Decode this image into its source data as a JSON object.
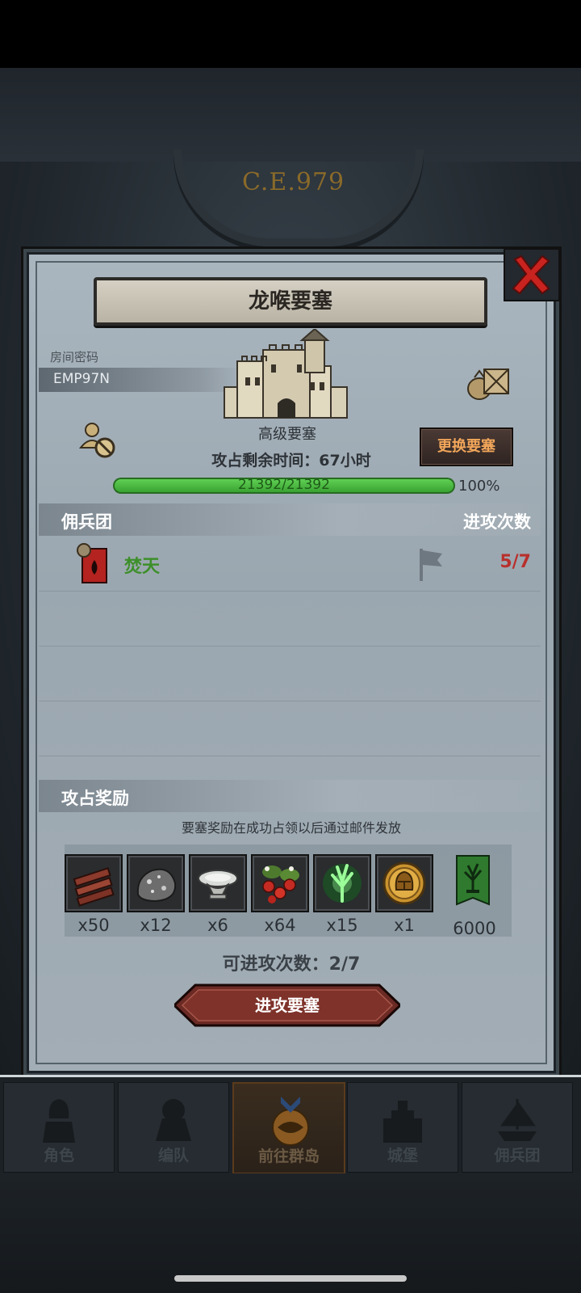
{
  "background": {
    "year_label": "C.E.979"
  },
  "modal": {
    "title": "龙喉要塞",
    "room_label": "房间密码",
    "room_code": "EMP97N",
    "fortress_type": "高级要塞",
    "change_button": "更换要塞",
    "time_label": "攻占剩余时间：",
    "time_value": "67",
    "time_unit": "小时",
    "hp_text": "21392/21392",
    "hp_percent": "100%",
    "hp_fraction": 1.0,
    "mercenary_header": "佣兵团",
    "attack_count_header": "进攻次数",
    "mercenaries": [
      {
        "name": "焚天",
        "attacks": "5/7"
      }
    ],
    "reward_header": "攻占奖励",
    "reward_note": "要塞奖励在成功占领以后通过邮件发放",
    "rewards": [
      {
        "icon": "wood-planks-icon",
        "qty": "x50"
      },
      {
        "icon": "stone-ore-icon",
        "qty": "x12"
      },
      {
        "icon": "silver-bowl-icon",
        "qty": "x6"
      },
      {
        "icon": "berries-icon",
        "qty": "x64"
      },
      {
        "icon": "green-spirit-tree-icon",
        "qty": "x15"
      },
      {
        "icon": "gold-helmet-coin-icon",
        "qty": "x1"
      },
      {
        "icon": "tree-banner-icon",
        "qty": "6000"
      }
    ],
    "attempts_text": "可进攻次数：2/7",
    "attack_button": "进攻要塞"
  },
  "nav": [
    {
      "label": "角色",
      "icon": "knight-icon"
    },
    {
      "label": "编队",
      "icon": "formation-icon"
    },
    {
      "label": "前往群岛",
      "icon": "island-map-icon",
      "active": true
    },
    {
      "label": "城堡",
      "icon": "castle-icon"
    },
    {
      "label": "佣兵团",
      "icon": "mercenary-ship-icon"
    }
  ],
  "colors": {
    "accent_green": "#3d8f2a",
    "attack_red": "#b8302d",
    "change_button_text": "#f2a65a"
  }
}
